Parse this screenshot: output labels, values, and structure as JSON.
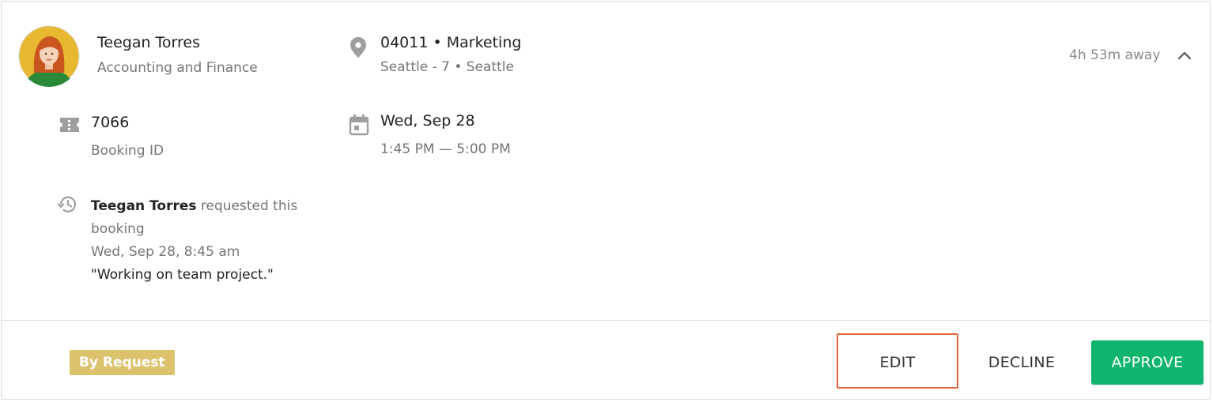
{
  "user": {
    "name": "Teegan Torres",
    "department": "Accounting and Finance"
  },
  "location": {
    "title": "04011 • Marketing",
    "subtitle": "Seattle - 7 • Seattle"
  },
  "status": {
    "away_text": "4h 53m away"
  },
  "booking": {
    "id": "7066",
    "id_label": "Booking ID",
    "date": "Wed, Sep 28",
    "time_range": "1:45 PM — 5:00 PM"
  },
  "history": {
    "requester": "Teegan Torres",
    "action": " requested this booking",
    "timestamp": "Wed, Sep 28, 8:45 am",
    "note": "\"Working on team project.\""
  },
  "footer": {
    "badge": "By Request",
    "edit_label": "EDIT",
    "decline_label": "DECLINE",
    "approve_label": "APPROVE"
  },
  "colors": {
    "approve": "#10b56d",
    "badge": "#dcc26d",
    "edit_highlight": "#e2683c",
    "icon_gray": "#9e9e9e"
  }
}
